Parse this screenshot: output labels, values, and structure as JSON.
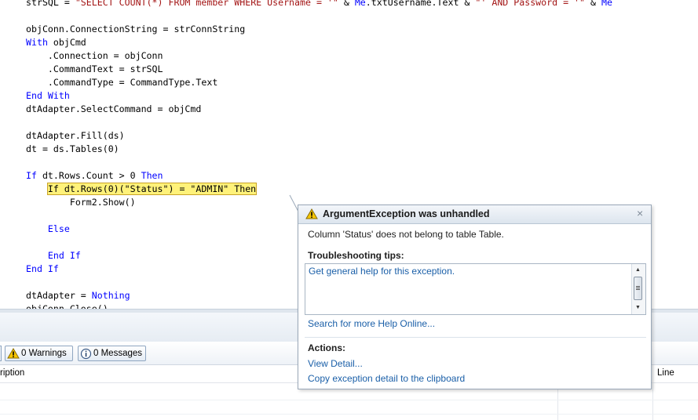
{
  "code_lines": [
    [
      {
        "t": "strSQL = ",
        "c": ""
      },
      {
        "t": "\"SELECT COUNT(*) FROM member WHERE Username = '\"",
        "c": "str"
      },
      {
        "t": " & ",
        "c": ""
      },
      {
        "t": "Me",
        "c": "kw"
      },
      {
        "t": ".txtUsername.Text & ",
        "c": ""
      },
      {
        "t": "\"' AND Password = '\"",
        "c": "str"
      },
      {
        "t": " & ",
        "c": ""
      },
      {
        "t": "Me",
        "c": "kw"
      }
    ],
    [],
    [
      {
        "t": "objConn.ConnectionString = strConnString",
        "c": ""
      }
    ],
    [
      {
        "t": "With",
        "c": "kw"
      },
      {
        "t": " objCmd",
        "c": ""
      }
    ],
    [
      {
        "t": "    .Connection = objConn",
        "c": ""
      }
    ],
    [
      {
        "t": "    .CommandText = strSQL",
        "c": ""
      }
    ],
    [
      {
        "t": "    .CommandType = CommandType.Text",
        "c": ""
      }
    ],
    [
      {
        "t": "End With",
        "c": "kw"
      }
    ],
    [
      {
        "t": "dtAdapter.SelectCommand = objCmd",
        "c": ""
      }
    ],
    [],
    [
      {
        "t": "dtAdapter.Fill(ds)",
        "c": ""
      }
    ],
    [
      {
        "t": "dt = ds.Tables(0)",
        "c": ""
      }
    ],
    [],
    [
      {
        "t": "If",
        "c": "kw"
      },
      {
        "t": " dt.Rows.Count > 0 ",
        "c": ""
      },
      {
        "t": "Then",
        "c": "kw"
      }
    ],
    [
      {
        "t": "    ",
        "c": ""
      },
      {
        "t": "If dt.Rows(0)(\"Status\") = \"ADMIN\" Then",
        "c": "hl"
      }
    ],
    [
      {
        "t": "        Form2.Show()",
        "c": ""
      }
    ],
    [],
    [
      {
        "t": "    ",
        "c": ""
      },
      {
        "t": "Else",
        "c": "kw"
      }
    ],
    [],
    [
      {
        "t": "    ",
        "c": ""
      },
      {
        "t": "End If",
        "c": "kw"
      }
    ],
    [
      {
        "t": "End If",
        "c": "kw"
      }
    ],
    [],
    [
      {
        "t": "dtAdapter = ",
        "c": ""
      },
      {
        "t": "Nothing",
        "c": "kw"
      }
    ],
    [
      {
        "t": "objConn.Close()",
        "c": ""
      }
    ]
  ],
  "error_list": {
    "warnings_label": "0 Warnings",
    "messages_label": "0 Messages",
    "col_description": "ription",
    "col_line": "Line"
  },
  "exception": {
    "title": "ArgumentException was unhandled",
    "message": "Column 'Status' does not belong to table Table.",
    "tips_heading": "Troubleshooting tips:",
    "tip_link": "Get general help for this exception.",
    "search_link": "Search for more Help Online...",
    "actions_heading": "Actions:",
    "view_detail": "View Detail...",
    "copy_detail": "Copy exception detail to the clipboard",
    "close_glyph": "×"
  },
  "colors": {
    "keyword": "#0000ff",
    "string": "#a31515",
    "highlight": "#fff27a",
    "link": "#1a5fa8"
  }
}
